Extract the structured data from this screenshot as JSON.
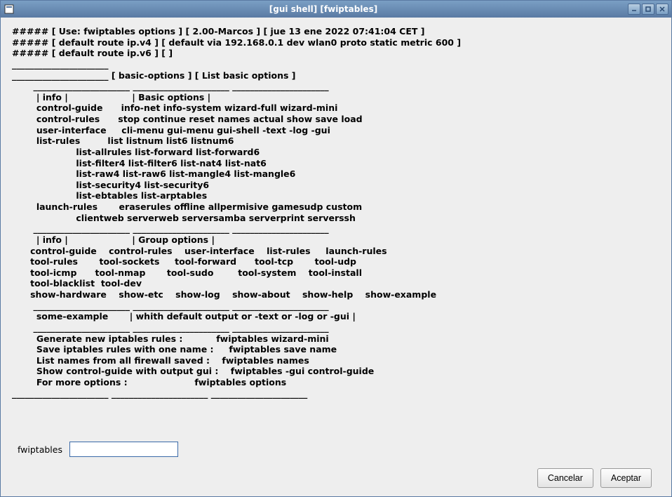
{
  "window": {
    "title": "[gui shell]  [fwiptables]"
  },
  "output": {
    "lines": [
      "##### [ Use: fwiptables options ] [ 2.00-Marcos ] [ jue 13 ene 2022 07:41:04 CET ]",
      "##### [ default route ip.v4 ] [ default via 192.168.0.1 dev wlan0 proto static metric 600 ]",
      "##### [ default route ip.v6 ] [ ]",
      "______________________",
      "______________________ [ basic-options ] [ List basic options ]",
      "       ______________________ ______________________ ______________________",
      "        | info |                     | Basic options |",
      "        control-guide      info-net info-system wizard-full wizard-mini",
      "        control-rules      stop continue reset names actual show save load",
      "        user-interface     cli-menu gui-menu gui-shell -text -log -gui",
      "        list-rules         list listnum list6 listnum6",
      "                     list-allrules list-forward list-forward6",
      "                     list-filter4 list-filter6 list-nat4 list-nat6",
      "                     list-raw4 list-raw6 list-mangle4 list-mangle6",
      "                     list-security4 list-security6",
      "                     list-ebtables list-arptables",
      "        launch-rules       eraserules offline allpermisive gamesudp custom",
      "                     clientweb serverweb serversamba serverprint serverssh",
      "       ______________________ ______________________ ______________________",
      "        | info |                     | Group options |",
      "      control-guide    control-rules    user-interface    list-rules     launch-rules",
      "      tool-rules       tool-sockets     tool-forward      tool-tcp       tool-udp",
      "      tool-icmp      tool-nmap       tool-sudo        tool-system    tool-install",
      "      tool-blacklist  tool-dev",
      "      show-hardware    show-etc    show-log    show-about    show-help    show-example",
      "       ______________________ ______________________ ______________________",
      "        some-example       | whith default output or -text or -log or -gui |",
      "       ______________________ ______________________ ______________________",
      "        Generate new iptables rules :           fwiptables wizard-mini",
      "        Save iptables rules with one name :     fwiptables save name",
      "        List names from all firewall saved :    fwiptables names",
      "        Show control-guide with output gui :    fwiptables -gui control-guide",
      "        For more options :                      fwiptables options",
      "______________________ ______________________ ______________________"
    ]
  },
  "input": {
    "label": "fwiptables",
    "value": ""
  },
  "buttons": {
    "cancel": "Cancelar",
    "accept": "Aceptar"
  }
}
